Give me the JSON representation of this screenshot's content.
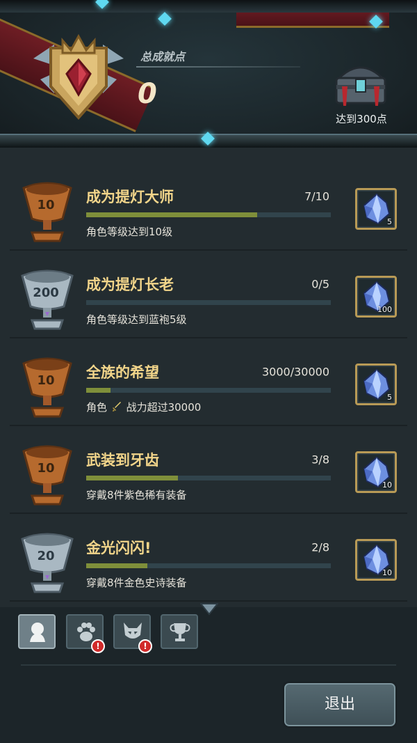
{
  "header": {
    "title": "总成就点",
    "score": "0",
    "chest_label": "达到300点"
  },
  "achievements": [
    {
      "cup": "10",
      "cup_type": "bronze",
      "title": "成为提灯大师",
      "progress": "7/10",
      "fraction": 0.7,
      "desc": "角色等级达到10级",
      "reward_count": "5"
    },
    {
      "cup": "200",
      "cup_type": "silver",
      "title": "成为提灯长老",
      "progress": "0/5",
      "fraction": 0.0,
      "desc": "角色等级达到蓝袍5级",
      "reward_count": "100"
    },
    {
      "cup": "10",
      "cup_type": "bronze",
      "title": "全族的希望",
      "progress": "3000/30000",
      "fraction": 0.1,
      "desc_pre": "角色",
      "desc_post": "战力超过30000",
      "reward_count": "5"
    },
    {
      "cup": "10",
      "cup_type": "bronze",
      "title": "武装到牙齿",
      "progress": "3/8",
      "fraction": 0.375,
      "desc": "穿戴8件紫色稀有装备",
      "reward_count": "10"
    },
    {
      "cup": "20",
      "cup_type": "silver",
      "title": "金光闪闪!",
      "progress": "2/8",
      "fraction": 0.25,
      "desc": "穿戴8件金色史诗装备",
      "reward_count": "10"
    }
  ],
  "tabs": [
    {
      "icon": "character-head-icon",
      "active": true,
      "alert": false
    },
    {
      "icon": "paw-icon",
      "active": false,
      "alert": true
    },
    {
      "icon": "mask-icon",
      "active": false,
      "alert": true
    },
    {
      "icon": "trophy-icon",
      "active": false,
      "alert": false
    }
  ],
  "exit_label": "退出",
  "colors": {
    "title_gold": "#f2d58a",
    "bar_fill": "#7f8f3a",
    "bar_track": "#31444c",
    "alert_red": "#d12a2a"
  }
}
